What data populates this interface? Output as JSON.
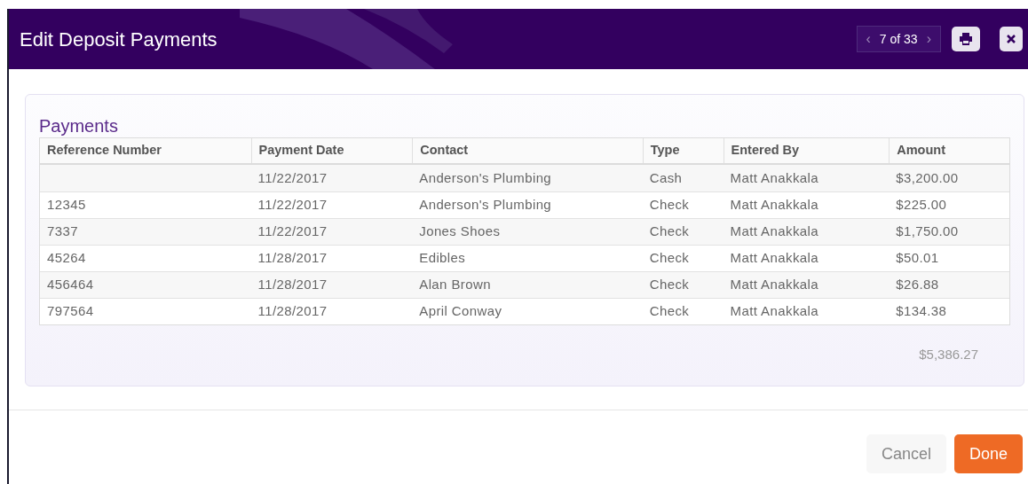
{
  "dialog": {
    "title": "Edit Deposit Payments",
    "pager": {
      "prev": "‹",
      "label": "7 of 33",
      "next": "›"
    }
  },
  "section": {
    "title": "Payments",
    "table": {
      "columns": [
        "Reference Number",
        "Payment Date",
        "Contact",
        "Type",
        "Entered By",
        "Amount"
      ],
      "rows": [
        [
          "",
          "11/22/2017",
          "Anderson's Plumbing",
          "Cash",
          "Matt Anakkala",
          "$3,200.00"
        ],
        [
          "12345",
          "11/22/2017",
          "Anderson's Plumbing",
          "Check",
          "Matt Anakkala",
          "$225.00"
        ],
        [
          "7337",
          "11/22/2017",
          "Jones Shoes",
          "Check",
          "Matt Anakkala",
          "$1,750.00"
        ],
        [
          "45264",
          "11/28/2017",
          "Edibles",
          "Check",
          "Matt Anakkala",
          "$50.01"
        ],
        [
          "456464",
          "11/28/2017",
          "Alan Brown",
          "Check",
          "Matt Anakkala",
          "$26.88"
        ],
        [
          "797564",
          "11/28/2017",
          "April Conway",
          "Check",
          "Matt Anakkala",
          "$134.38"
        ]
      ]
    },
    "total": "$5,386.27"
  },
  "buttons": [
    {
      "label": "Cancel",
      "kind": "secondary"
    },
    {
      "label": "Done",
      "kind": "primary"
    }
  ]
}
